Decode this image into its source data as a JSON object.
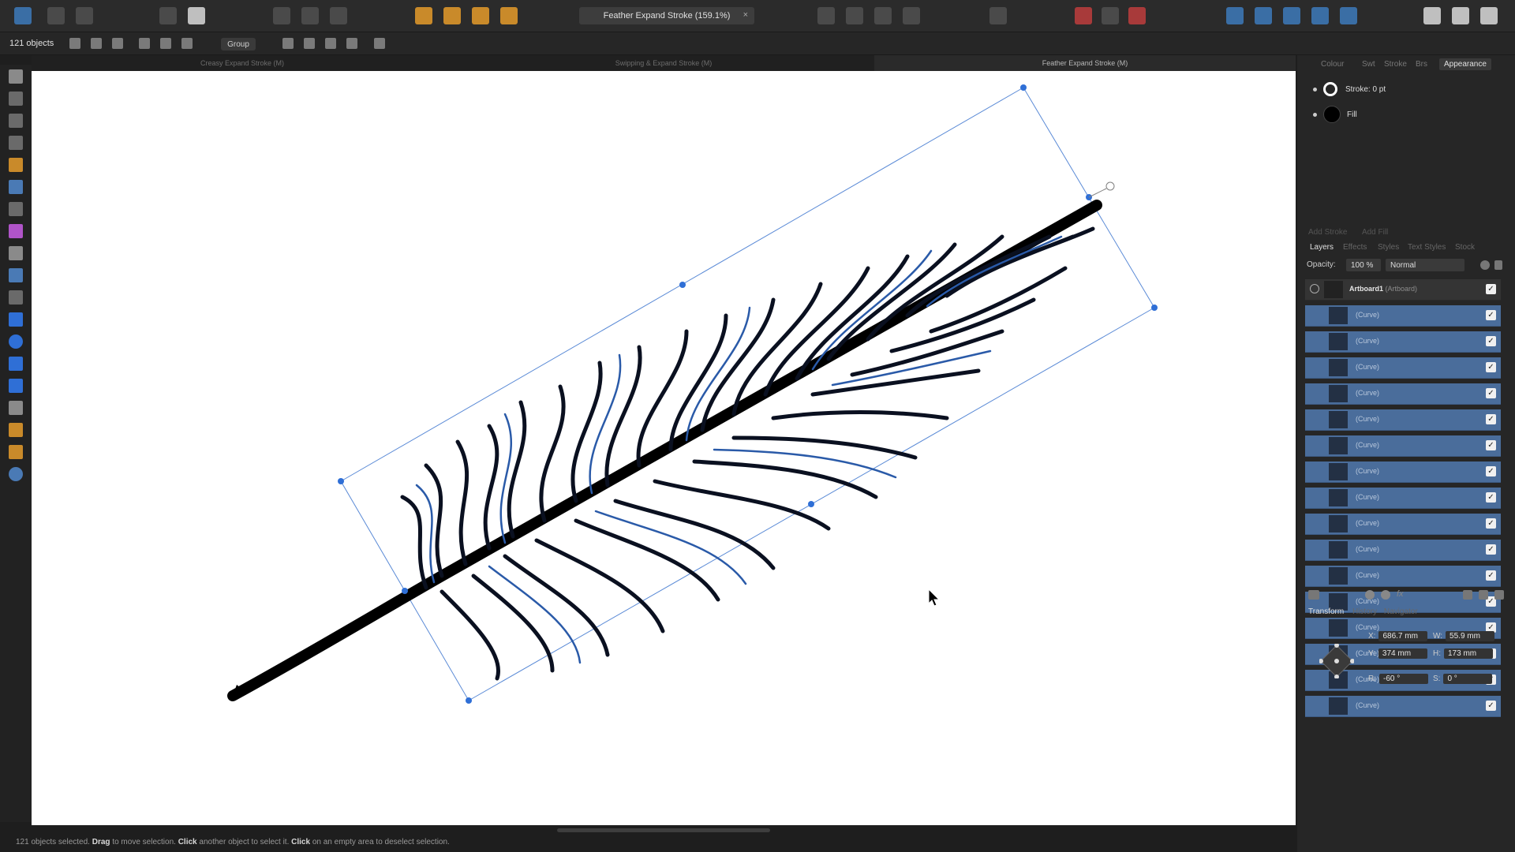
{
  "toolbar": {
    "document_title": "Feather Expand Stroke (159.1%)",
    "close_glyph": "×"
  },
  "context": {
    "object_count": "121 objects",
    "group_label": "Group"
  },
  "doc_tabs": [
    {
      "label": "Creasy Expand Stroke (M)"
    },
    {
      "label": "Swipping & Expand Stroke (M)"
    },
    {
      "label": "Feather Expand Stroke (M)"
    }
  ],
  "panel_tabs": [
    "Colour",
    "Swt",
    "Stroke",
    "Brs",
    "Appearance"
  ],
  "appearance": {
    "stroke_label": "Stroke: 0 pt",
    "fill_label": "Fill"
  },
  "faded_row": {
    "add_stroke": "Add Stroke",
    "add_fill": "Add Fill"
  },
  "layer_tabs": [
    "Layers",
    "Effects",
    "Styles",
    "Text Styles",
    "Stock"
  ],
  "opacity": {
    "label": "Opacity:",
    "value": "100 %",
    "blend": "Normal"
  },
  "artboard": {
    "name": "Artboard1",
    "type": "(Artboard)"
  },
  "layers": [
    "(Curve)",
    "(Curve)",
    "(Curve)",
    "(Curve)",
    "(Curve)",
    "(Curve)",
    "(Curve)",
    "(Curve)",
    "(Curve)",
    "(Curve)",
    "(Curve)",
    "(Curve)",
    "(Curve)",
    "(Curve)",
    "(Curve)",
    "(Curve)"
  ],
  "transform_tabs": [
    "Transform",
    "History",
    "Navigator"
  ],
  "transform": {
    "x_label": "X:",
    "x": "686.7 mm",
    "y_label": "Y:",
    "y": "374 mm",
    "w_label": "W:",
    "w": "55.9 mm",
    "h_label": "H:",
    "h": "173 mm",
    "r_label": "R:",
    "r": "-60 °",
    "s_label": "S:",
    "s": "0 °"
  },
  "status": {
    "selected": "121 objects selected.",
    "drag_word": "Drag",
    "drag_text": "to move selection.",
    "click_word": "Click",
    "click_text": "another object to select it.",
    "click_word2": "Click",
    "click_text2": "on an empty area to deselect selection."
  },
  "colors": {
    "accent": "#3a6ea5",
    "selection": "#4a6d9b",
    "handle": "#2f6fd6"
  }
}
